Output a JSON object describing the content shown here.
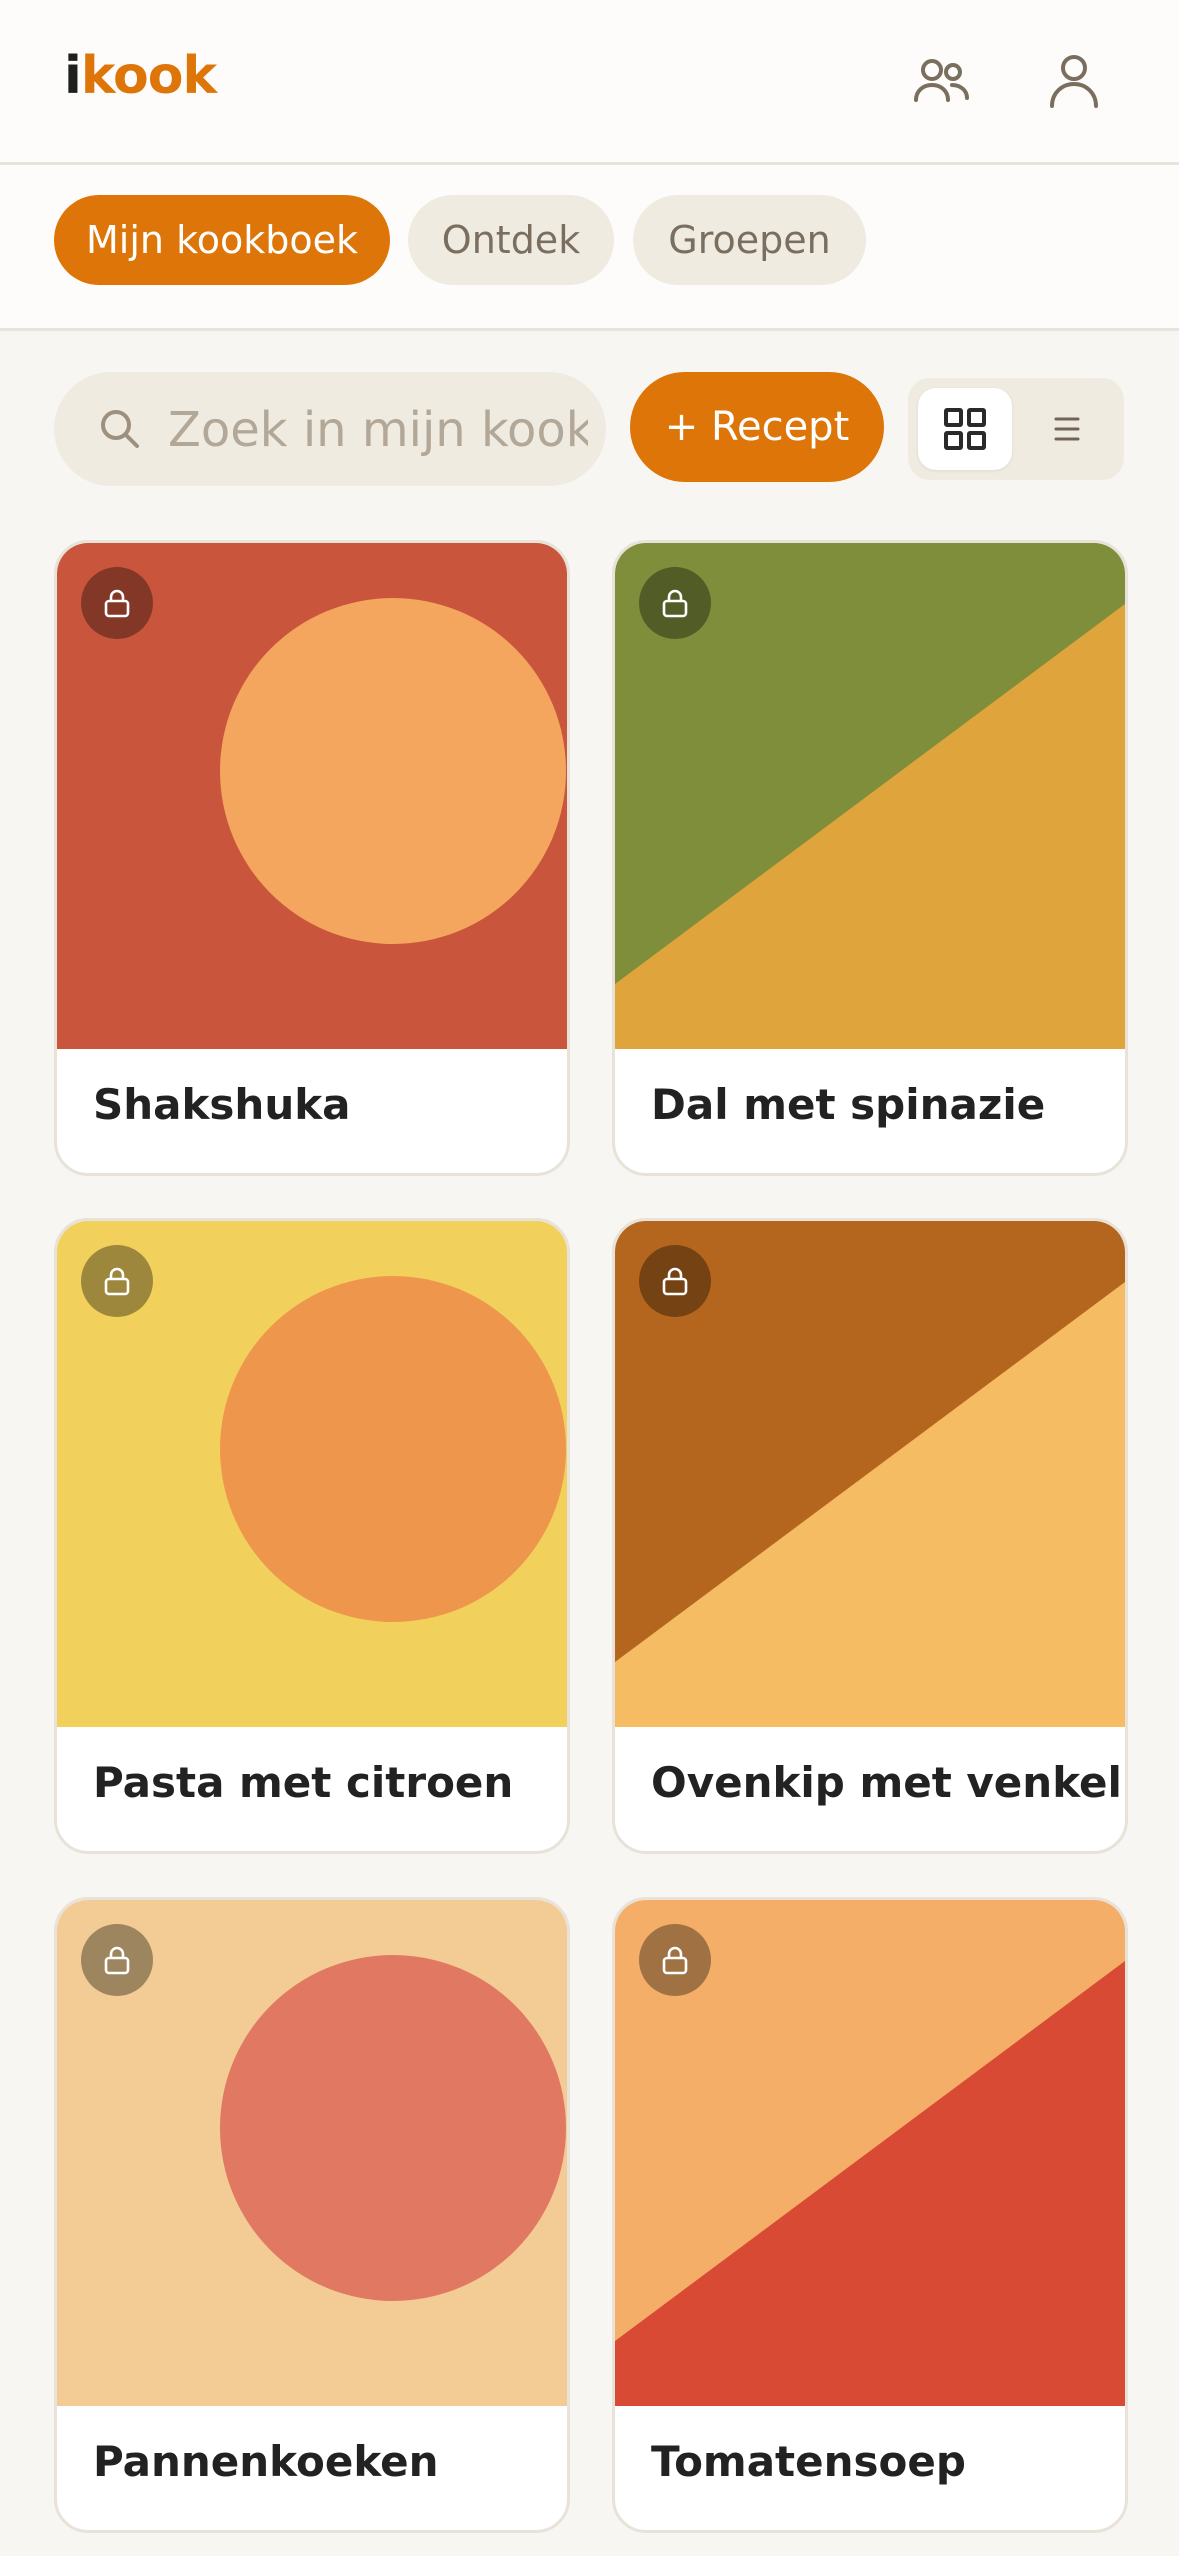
{
  "header": {
    "logo_i": "i",
    "logo_kook": "kook",
    "groups_icon": "users-icon",
    "profile_icon": "user-icon"
  },
  "tabs": [
    {
      "label": "Mijn kookboek",
      "active": true
    },
    {
      "label": "Ontdek",
      "active": false
    },
    {
      "label": "Groepen",
      "active": false
    }
  ],
  "search": {
    "placeholder": "Zoek in mijn kookboek",
    "value": ""
  },
  "toolbar": {
    "add_label": "+ Recept",
    "view_grid_icon": "grid-icon",
    "view_list_icon": "list-icon",
    "active_view": "grid"
  },
  "recipes": [
    {
      "title": "Shakshuka",
      "private": true,
      "bg": "#c9563c",
      "shape": "circle",
      "shape_color": "#f4a55e"
    },
    {
      "title": "Dal met spinazie",
      "private": true,
      "bg": "#7e8e3b",
      "shape": "diagonal",
      "shape_color": "#dfa43b"
    },
    {
      "title": "Pasta met citroen",
      "private": true,
      "bg": "#f2d05c",
      "shape": "circle",
      "shape_color": "#ee964c"
    },
    {
      "title": "Ovenkip met venkel",
      "private": true,
      "bg": "#b4661e",
      "shape": "diagonal",
      "shape_color": "#f5bc63"
    },
    {
      "title": "Pannenkoeken",
      "private": true,
      "bg": "#f2cc94",
      "shape": "circle",
      "shape_color": "#e17861"
    },
    {
      "title": "Tomatensoep",
      "private": true,
      "bg": "#f5ae68",
      "shape": "diagonal",
      "shape_color": "#d84a33"
    }
  ],
  "colors": {
    "accent": "#dd7509",
    "background": "#f8f6f2",
    "chip_bg": "#f0ebe1"
  }
}
